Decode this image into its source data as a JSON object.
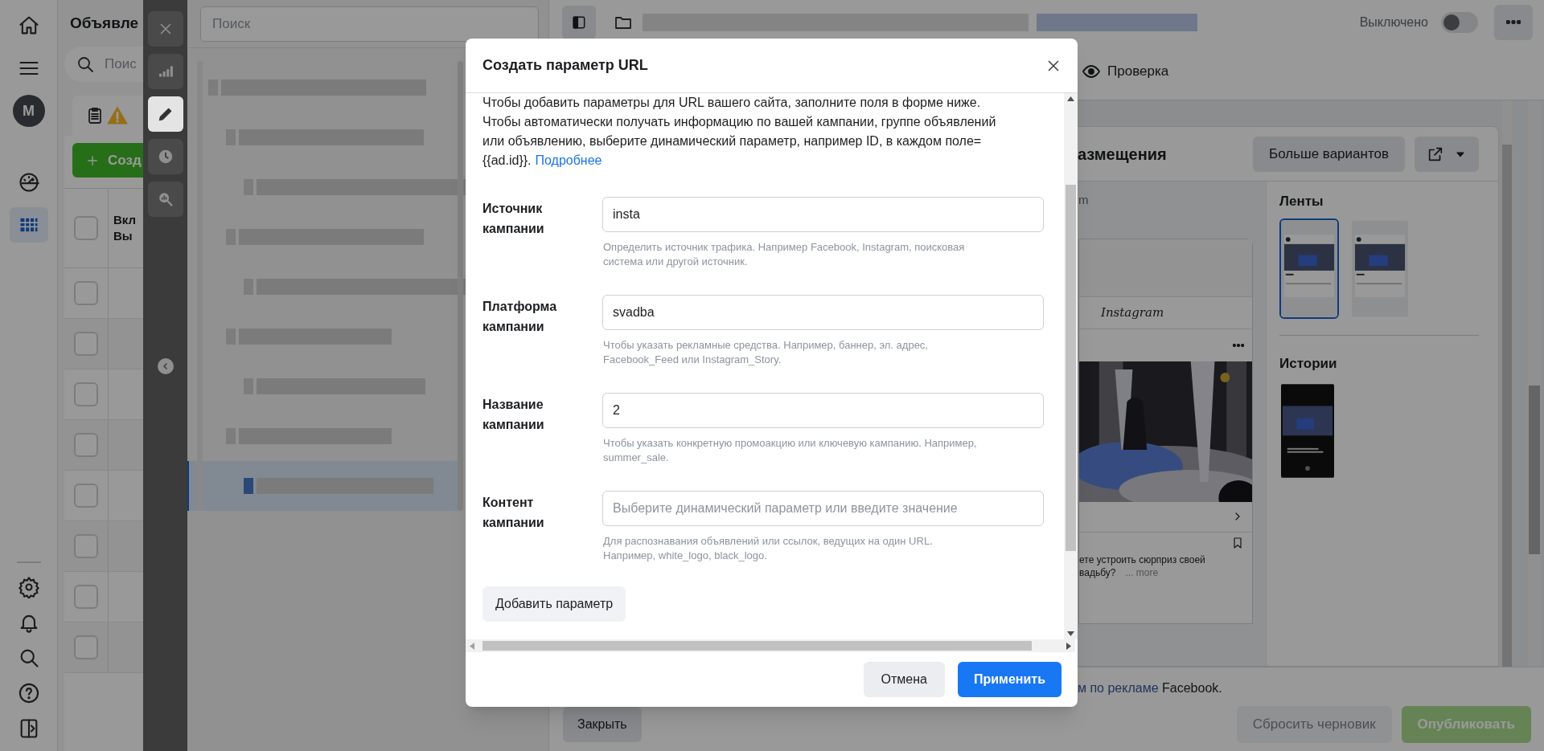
{
  "left_nav": {
    "top_items": [
      {
        "kind": "home",
        "selected": false
      },
      {
        "kind": "menu",
        "selected": false
      },
      {
        "kind": "avatar",
        "label": "M",
        "selected": false
      },
      {
        "kind": "gauge",
        "selected": false
      },
      {
        "kind": "table",
        "selected": true
      }
    ],
    "bottom_items": [
      {
        "kind": "settings",
        "selected": false
      },
      {
        "kind": "bell",
        "selected": false
      },
      {
        "kind": "search",
        "selected": false
      },
      {
        "kind": "help",
        "selected": false
      },
      {
        "kind": "panel",
        "selected": false
      }
    ]
  },
  "ads_panel": {
    "title": "Объявле",
    "search": {
      "placeholder": "Поис"
    },
    "create_button": "Созд",
    "column_header": [
      "Вкл",
      "Вы"
    ],
    "select_all": {
      "checked": false
    },
    "rows": [
      {
        "checked": false
      },
      {
        "checked": false
      },
      {
        "checked": false
      },
      {
        "checked": false
      },
      {
        "checked": false
      },
      {
        "checked": false
      },
      {
        "checked": false
      },
      {
        "checked": false
      }
    ]
  },
  "tool_strip": {
    "items": [
      {
        "kind": "close",
        "selected": false
      },
      {
        "kind": "chart",
        "selected": false
      },
      {
        "kind": "edit",
        "selected": true
      },
      {
        "kind": "history",
        "selected": false
      },
      {
        "kind": "inspect",
        "selected": false
      }
    ]
  },
  "tree_panel": {
    "search": {
      "placeholder": "Поиск"
    },
    "items": [
      {
        "selected": false,
        "children": [
          {
            "selected": false,
            "children": [
              {
                "selected": false
              }
            ]
          },
          {
            "selected": false,
            "children": [
              {
                "selected": false
              }
            ]
          },
          {
            "selected": false,
            "children": [
              {
                "selected": false
              }
            ]
          },
          {
            "selected": false,
            "children": [
              {
                "selected": true
              }
            ]
          }
        ]
      }
    ]
  },
  "top_bar": {
    "status_label": "Выключено",
    "on": false
  },
  "review_tab": {
    "label": "Проверка",
    "selected": false
  },
  "preview": {
    "title": "азмещения",
    "more_button": "Больше вариантов",
    "note": "m",
    "post": {
      "logo": "Instagram",
      "caption_lines": [
        "ете устроить сюрприз своей",
        "вадьбу?"
      ],
      "more": "... more"
    },
    "feeds": {
      "title": "Ленты",
      "thumbnails": [
        {
          "selected": true
        },
        {
          "selected": false
        }
      ]
    },
    "stories": {
      "title": "Истории",
      "thumbnails": [
        {
          "selected": false
        }
      ]
    }
  },
  "footer": {
    "notice_link": "м по рекламе",
    "notice_text": "Facebook.",
    "close_button": "Закрыть",
    "reset_button": {
      "label": "Сбросить черновик",
      "disabled": true
    },
    "publish_button": {
      "label": "Опубликовать",
      "disabled": true
    }
  },
  "modal": {
    "title": "Создать параметр URL",
    "intro": "Чтобы добавить параметры для URL вашего сайта, заполните поля в форме ниже. Чтобы автоматически получать информацию по вашей кампании, группе объявлений или объявлению, выберите динамический параметр, например ID, в каждом поле= {{ad.id}}.",
    "intro_link": "Подробнее",
    "fields": [
      {
        "label": "Источник кампании",
        "value": "insta",
        "hint": "Определить источник трафика. Например Facebook, Instagram, поисковая система или другой источник."
      },
      {
        "label": "Платформа кампании",
        "value": "svadba",
        "hint": "Чтобы указать рекламные средства. Например, баннер, эл. адрес, Facebook_Feed или Instagram_Story."
      },
      {
        "label": "Название кампании",
        "value": "2",
        "hint": "Чтобы указать конкретную промоакцию или ключевую кампанию. Например, summer_sale."
      },
      {
        "label": "Контент кампании",
        "placeholder": "Выберите динамический параметр или введите значение",
        "hint": "Для распознавания объявлений или ссылок, ведущих на один URL. Например, white_logo, black_logo."
      }
    ],
    "add_button": "Добавить параметр",
    "cancel_button": "Отмена",
    "apply_button": "Применить"
  }
}
